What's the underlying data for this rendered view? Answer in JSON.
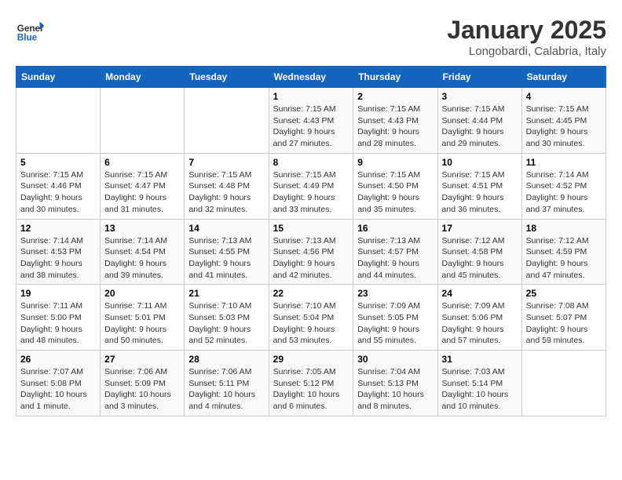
{
  "header": {
    "logo_line1": "General",
    "logo_line2": "Blue",
    "month": "January 2025",
    "location": "Longobardi, Calabria, Italy"
  },
  "weekdays": [
    "Sunday",
    "Monday",
    "Tuesday",
    "Wednesday",
    "Thursday",
    "Friday",
    "Saturday"
  ],
  "weeks": [
    [
      {
        "day": "",
        "info": ""
      },
      {
        "day": "",
        "info": ""
      },
      {
        "day": "",
        "info": ""
      },
      {
        "day": "1",
        "info": "Sunrise: 7:15 AM\nSunset: 4:43 PM\nDaylight: 9 hours and 27 minutes."
      },
      {
        "day": "2",
        "info": "Sunrise: 7:15 AM\nSunset: 4:43 PM\nDaylight: 9 hours and 28 minutes."
      },
      {
        "day": "3",
        "info": "Sunrise: 7:15 AM\nSunset: 4:44 PM\nDaylight: 9 hours and 29 minutes."
      },
      {
        "day": "4",
        "info": "Sunrise: 7:15 AM\nSunset: 4:45 PM\nDaylight: 9 hours and 30 minutes."
      }
    ],
    [
      {
        "day": "5",
        "info": "Sunrise: 7:15 AM\nSunset: 4:46 PM\nDaylight: 9 hours and 30 minutes."
      },
      {
        "day": "6",
        "info": "Sunrise: 7:15 AM\nSunset: 4:47 PM\nDaylight: 9 hours and 31 minutes."
      },
      {
        "day": "7",
        "info": "Sunrise: 7:15 AM\nSunset: 4:48 PM\nDaylight: 9 hours and 32 minutes."
      },
      {
        "day": "8",
        "info": "Sunrise: 7:15 AM\nSunset: 4:49 PM\nDaylight: 9 hours and 33 minutes."
      },
      {
        "day": "9",
        "info": "Sunrise: 7:15 AM\nSunset: 4:50 PM\nDaylight: 9 hours and 35 minutes."
      },
      {
        "day": "10",
        "info": "Sunrise: 7:15 AM\nSunset: 4:51 PM\nDaylight: 9 hours and 36 minutes."
      },
      {
        "day": "11",
        "info": "Sunrise: 7:14 AM\nSunset: 4:52 PM\nDaylight: 9 hours and 37 minutes."
      }
    ],
    [
      {
        "day": "12",
        "info": "Sunrise: 7:14 AM\nSunset: 4:53 PM\nDaylight: 9 hours and 38 minutes."
      },
      {
        "day": "13",
        "info": "Sunrise: 7:14 AM\nSunset: 4:54 PM\nDaylight: 9 hours and 39 minutes."
      },
      {
        "day": "14",
        "info": "Sunrise: 7:13 AM\nSunset: 4:55 PM\nDaylight: 9 hours and 41 minutes."
      },
      {
        "day": "15",
        "info": "Sunrise: 7:13 AM\nSunset: 4:56 PM\nDaylight: 9 hours and 42 minutes."
      },
      {
        "day": "16",
        "info": "Sunrise: 7:13 AM\nSunset: 4:57 PM\nDaylight: 9 hours and 44 minutes."
      },
      {
        "day": "17",
        "info": "Sunrise: 7:12 AM\nSunset: 4:58 PM\nDaylight: 9 hours and 45 minutes."
      },
      {
        "day": "18",
        "info": "Sunrise: 7:12 AM\nSunset: 4:59 PM\nDaylight: 9 hours and 47 minutes."
      }
    ],
    [
      {
        "day": "19",
        "info": "Sunrise: 7:11 AM\nSunset: 5:00 PM\nDaylight: 9 hours and 48 minutes."
      },
      {
        "day": "20",
        "info": "Sunrise: 7:11 AM\nSunset: 5:01 PM\nDaylight: 9 hours and 50 minutes."
      },
      {
        "day": "21",
        "info": "Sunrise: 7:10 AM\nSunset: 5:03 PM\nDaylight: 9 hours and 52 minutes."
      },
      {
        "day": "22",
        "info": "Sunrise: 7:10 AM\nSunset: 5:04 PM\nDaylight: 9 hours and 53 minutes."
      },
      {
        "day": "23",
        "info": "Sunrise: 7:09 AM\nSunset: 5:05 PM\nDaylight: 9 hours and 55 minutes."
      },
      {
        "day": "24",
        "info": "Sunrise: 7:09 AM\nSunset: 5:06 PM\nDaylight: 9 hours and 57 minutes."
      },
      {
        "day": "25",
        "info": "Sunrise: 7:08 AM\nSunset: 5:07 PM\nDaylight: 9 hours and 59 minutes."
      }
    ],
    [
      {
        "day": "26",
        "info": "Sunrise: 7:07 AM\nSunset: 5:08 PM\nDaylight: 10 hours and 1 minute."
      },
      {
        "day": "27",
        "info": "Sunrise: 7:06 AM\nSunset: 5:09 PM\nDaylight: 10 hours and 3 minutes."
      },
      {
        "day": "28",
        "info": "Sunrise: 7:06 AM\nSunset: 5:11 PM\nDaylight: 10 hours and 4 minutes."
      },
      {
        "day": "29",
        "info": "Sunrise: 7:05 AM\nSunset: 5:12 PM\nDaylight: 10 hours and 6 minutes."
      },
      {
        "day": "30",
        "info": "Sunrise: 7:04 AM\nSunset: 5:13 PM\nDaylight: 10 hours and 8 minutes."
      },
      {
        "day": "31",
        "info": "Sunrise: 7:03 AM\nSunset: 5:14 PM\nDaylight: 10 hours and 10 minutes."
      },
      {
        "day": "",
        "info": ""
      }
    ]
  ]
}
